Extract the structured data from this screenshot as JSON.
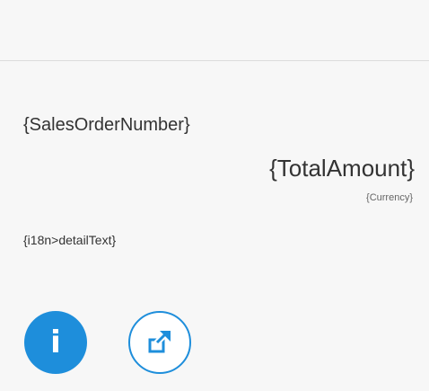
{
  "header": {
    "title": ""
  },
  "detail": {
    "sales_order_number": "{SalesOrderNumber}",
    "total_amount": "{TotalAmount}",
    "currency": "{Currency}",
    "detail_text": "{i18n>detailText}"
  },
  "actions": [
    {
      "name": "info",
      "icon": "info-icon",
      "glyph": "i"
    },
    {
      "name": "share",
      "icon": "share-icon"
    }
  ],
  "colors": {
    "accent": "#1e8edb",
    "background": "#f7f7f7",
    "text": "#333333"
  }
}
